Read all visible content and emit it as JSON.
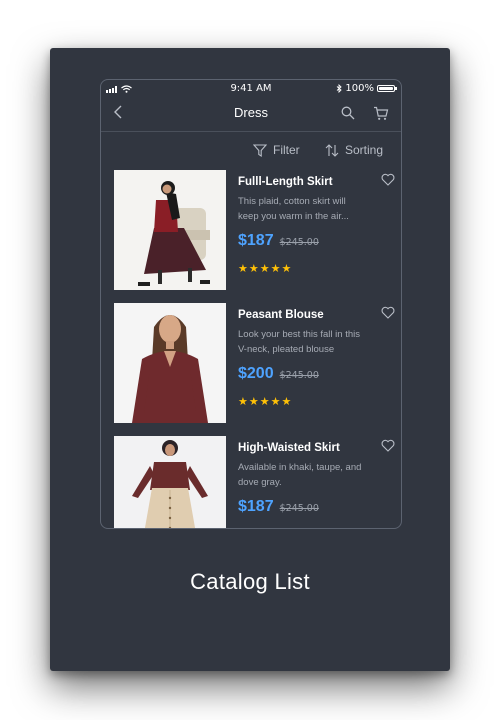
{
  "status": {
    "time": "9:41 AM",
    "battery": "100%"
  },
  "nav": {
    "title": "Dress",
    "back_icon": "chevron-left-icon",
    "search_icon": "search-icon",
    "cart_icon": "cart-icon"
  },
  "toolbar": {
    "filter_label": "Filter",
    "sorting_label": "Sorting"
  },
  "products": [
    {
      "name": "Fulll-Length Skirt",
      "desc_line1": "This plaid, cotton skirt will",
      "desc_line2": "keep you warm in the air...",
      "price": "$187",
      "old_price": "$245.00",
      "rating": 5
    },
    {
      "name": "Peasant Blouse",
      "desc_line1": "Look your best this fall in this",
      "desc_line2": "V-neck, pleated blouse",
      "price": "$200",
      "old_price": "$245.00",
      "rating": 5
    },
    {
      "name": "High-Waisted Skirt",
      "desc_line1": "Available in khaki, taupe, and",
      "desc_line2": "dove gray.",
      "price": "$187",
      "old_price": "$245.00"
    }
  ],
  "caption": "Catalog List",
  "colors": {
    "background": "#313640",
    "accent": "#4ea3ff",
    "star": "#ffc107"
  }
}
